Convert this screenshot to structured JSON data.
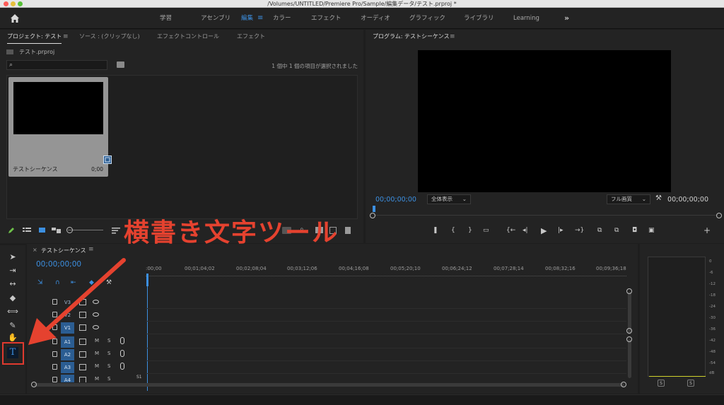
{
  "window": {
    "title": "/Volumes/UNTITLED/Premiere Pro/Sample/編集データ/テスト.prproj *",
    "dots": [
      "#fc5b57",
      "#e5bf3c",
      "#57c038"
    ]
  },
  "workspaces": {
    "tabs": [
      "学習",
      "アセンブリ",
      "編集",
      "カラー",
      "エフェクト",
      "オーディオ",
      "グラフィック",
      "ライブラリ",
      "Learning"
    ],
    "active": "編集",
    "menu_glyph": "≡",
    "more": "»"
  },
  "project_panel": {
    "tabs": [
      "プロジェクト: テスト",
      "ソース : (クリップなし)",
      "エフェクトコントロール",
      "エフェクト"
    ],
    "menu_glyph": "≡",
    "file_name": "テスト.prproj",
    "selection_status": "1 個中 1 個の項目が選択されました",
    "clip": {
      "name": "テストシーケンス",
      "duration": "0;00"
    }
  },
  "program_monitor": {
    "tab": "プログラム: テストシーケンス",
    "menu_glyph": "≡",
    "timecode_current": "00;00;00;00",
    "timecode_duration": "00;00;00;00",
    "fit": "全体表示",
    "resolution": "フル画質",
    "transport": [
      "❚",
      "{",
      "}",
      "▭",
      "{←",
      "◂|",
      "▶",
      "|▸",
      "→}",
      "⧉",
      "⧉",
      "◘",
      "▣",
      "+"
    ]
  },
  "timeline": {
    "close": "×",
    "tab": "テストシーケンス",
    "menu_glyph": "≡",
    "timecode": "00;00;00;00",
    "ruler_labels": [
      ":00;00",
      "00;01;04;02",
      "00;02;08;04",
      "00;03;12;06",
      "00;04;16;08",
      "00;05;20;10",
      "00;06;24;12",
      "00;07;28;14",
      "00;08;32;16",
      "00;09;36;18"
    ],
    "video_tracks": [
      "V3",
      "V2",
      "V1"
    ],
    "audio_tracks": [
      "A1",
      "A2",
      "A3",
      "A4"
    ],
    "audio_m": "M",
    "audio_s": "S",
    "partial_label": "S1",
    "tool_glyphs": [
      "⇲",
      "∩",
      "⇤",
      "◆",
      "⚒"
    ]
  },
  "tools": {
    "glyphs": [
      "➤",
      "⇥",
      "↔",
      "◆",
      "⟺",
      "✎",
      "✋"
    ],
    "type_tool": "T"
  },
  "audio_meter": {
    "db_labels": [
      "0",
      "-6",
      "-12",
      "-18",
      "-24",
      "-30",
      "-36",
      "-42",
      "-48",
      "-54",
      "dB"
    ],
    "solo": "S"
  },
  "annotation": {
    "text": "横書き文字ツール",
    "color": "#e5422f"
  }
}
